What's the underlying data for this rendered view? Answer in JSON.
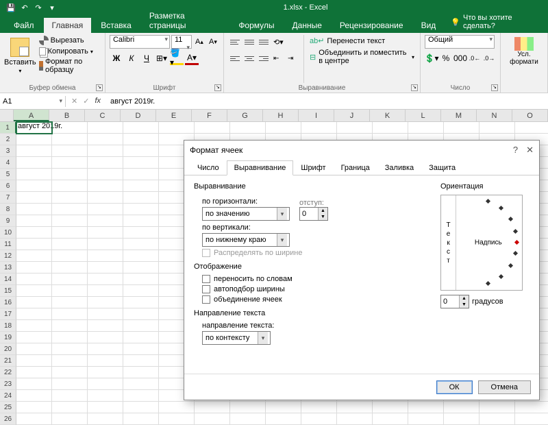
{
  "titlebar": {
    "title": "1.xlsx - Excel"
  },
  "tabs": {
    "file": "Файл",
    "home": "Главная",
    "insert": "Вставка",
    "pagelayout": "Разметка страницы",
    "formulas": "Формулы",
    "data": "Данные",
    "review": "Рецензирование",
    "view": "Вид",
    "tellme": "Что вы хотите сделать?"
  },
  "ribbon": {
    "clipboard": {
      "paste": "Вставить",
      "cut": "Вырезать",
      "copy": "Копировать",
      "format_painter": "Формат по образцу",
      "group": "Буфер обмена"
    },
    "font": {
      "name": "Calibri",
      "size": "11",
      "bold": "Ж",
      "italic": "К",
      "underline": "Ч",
      "group": "Шрифт"
    },
    "align": {
      "wrap": "Перенести текст",
      "merge": "Объединить и поместить в центре",
      "group": "Выравнивание"
    },
    "number": {
      "format": "Общий",
      "group": "Число"
    },
    "styles": {
      "cond": "Усл.\nформати"
    }
  },
  "namebox": "A1",
  "formula": "август 2019г.",
  "columns": [
    "A",
    "B",
    "C",
    "D",
    "E",
    "F",
    "G",
    "H",
    "I",
    "J",
    "K",
    "L",
    "M",
    "N",
    "O"
  ],
  "rowcount": 26,
  "cells": {
    "A1": "август 2019г."
  },
  "dialog": {
    "title": "Формат ячеек",
    "tabs": {
      "number": "Число",
      "align": "Выравнивание",
      "font": "Шрифт",
      "border": "Граница",
      "fill": "Заливка",
      "protect": "Защита"
    },
    "align_section": "Выравнивание",
    "h_label": "по горизонтали:",
    "h_value": "по значению",
    "indent_label": "отступ:",
    "indent_value": "0",
    "v_label": "по вертикали:",
    "v_value": "по нижнему краю",
    "distribute": "Распределять по ширине",
    "display_section": "Отображение",
    "wrap": "переносить по словам",
    "autofit": "автоподбор ширины",
    "merge": "объединение ячеек",
    "textdir_section": "Направление текста",
    "textdir_label": "направление текста:",
    "textdir_value": "по контексту",
    "orientation": "Ориентация",
    "orient_text": "Текст",
    "orient_caption": "Надпись",
    "deg_value": "0",
    "deg_label": "градусов",
    "ok": "ОК",
    "cancel": "Отмена"
  }
}
